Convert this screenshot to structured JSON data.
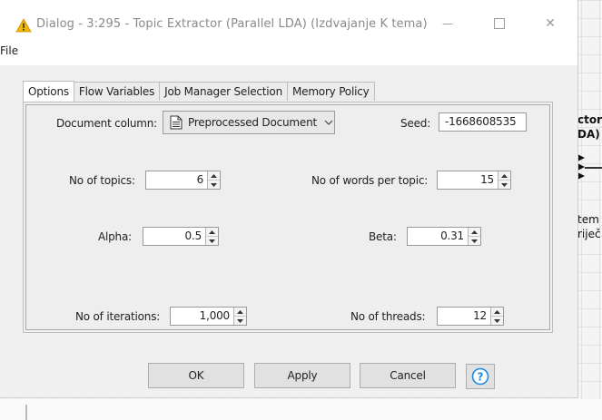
{
  "window": {
    "title": "Dialog - 3:295 - Topic Extractor (Parallel LDA) (Izdvajanje K tema)",
    "minimize_glyph": "—",
    "close_glyph": "✕"
  },
  "menu": {
    "file": "File"
  },
  "tabs": [
    {
      "label": "Options",
      "active": true
    },
    {
      "label": "Flow Variables",
      "active": false
    },
    {
      "label": "Job Manager Selection",
      "active": false
    },
    {
      "label": "Memory Policy",
      "active": false
    }
  ],
  "options": {
    "document_column_label": "Document column:",
    "document_column_value": "Preprocessed Document",
    "seed_label": "Seed:",
    "seed_value": "-1668608535",
    "topics_label": "No of topics:",
    "topics_value": "6",
    "words_label": "No of words per topic:",
    "words_value": "15",
    "alpha_label": "Alpha:",
    "alpha_value": "0.5",
    "beta_label": "Beta:",
    "beta_value": "0.31",
    "iterations_label": "No of iterations:",
    "iterations_value": "1,000",
    "threads_label": "No of threads:",
    "threads_value": "12"
  },
  "buttons": {
    "ok": "OK",
    "apply": "Apply",
    "cancel": "Cancel",
    "help": "?"
  },
  "background": {
    "node_name": "ctor\nDA)",
    "node_label": "tem\nriječ"
  },
  "colors": {
    "warning": "#f2b705",
    "help_accent": "#1e88e5"
  }
}
